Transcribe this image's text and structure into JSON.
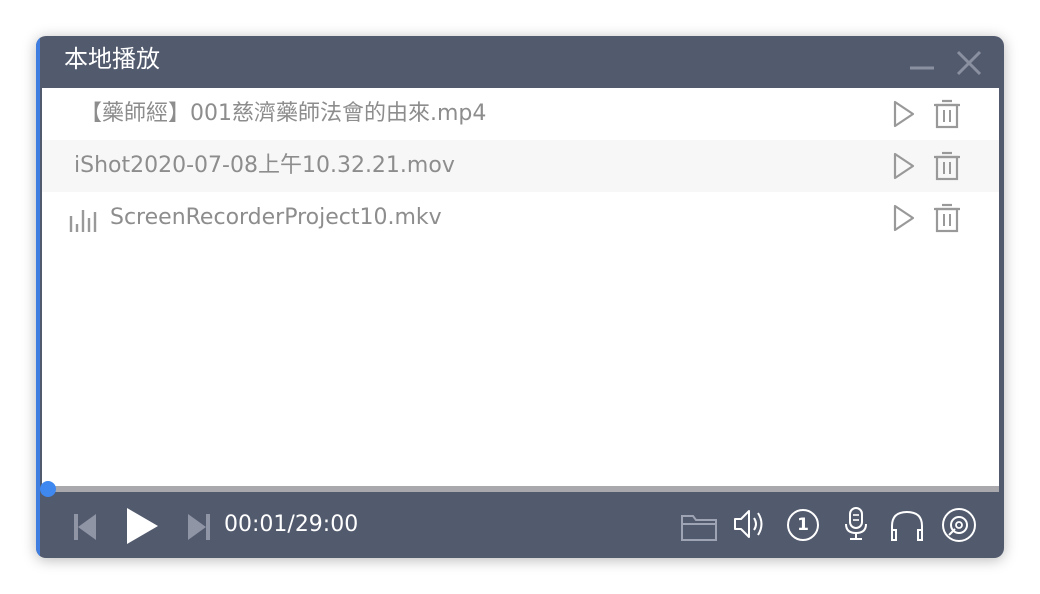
{
  "window": {
    "title": "本地播放",
    "accent_color": "#3f7ee0",
    "background_color": "#525a6e"
  },
  "titlebar": {
    "buttons": [
      {
        "name": "minimize",
        "icon": "minus-icon"
      },
      {
        "name": "close",
        "icon": "close-icon"
      }
    ]
  },
  "playlist": {
    "items": [
      {
        "name": "【藥師經】001慈濟藥師法會的由來.mp4",
        "playing": false,
        "actions": [
          "play-icon",
          "trash-icon"
        ]
      },
      {
        "name": "iShot2020-07-08上午10.32.21.mov",
        "playing": false,
        "actions": [
          "play-icon",
          "trash-icon"
        ]
      },
      {
        "name": "ScreenRecorderProject10.mkv",
        "playing": true,
        "playing_icon": "equalizer-icon",
        "actions": [
          "play-icon",
          "trash-icon"
        ]
      }
    ]
  },
  "player": {
    "progress_fraction": 0.0006,
    "current_time": "00:01",
    "total_time": "29:00",
    "time_display": "00:01/29:00",
    "progress_color": "#3f88f0",
    "loop_count": "1",
    "controls_left": [
      "previous-icon",
      "play-icon",
      "next-icon"
    ],
    "controls_right": [
      "folder-icon",
      "volume-icon",
      "loop-once-icon",
      "microphone-icon",
      "headphones-icon",
      "disc-icon"
    ]
  }
}
